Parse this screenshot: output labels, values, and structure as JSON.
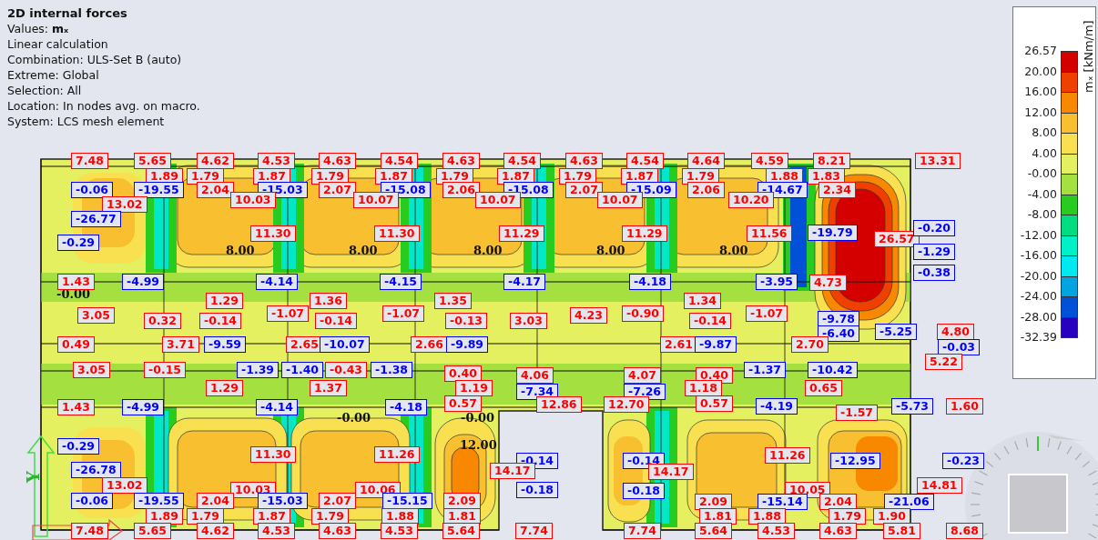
{
  "info": {
    "title": "2D internal forces",
    "lines": [
      "Values: **mₓ**",
      "Linear calculation",
      "Combination: ULS-Set B (auto)",
      "Extreme: Global",
      "Selection: All",
      "Location: In nodes avg. on macro.",
      "System: LCS mesh element"
    ]
  },
  "legend": {
    "title": "mₓ [kNm/m]",
    "ticks": [
      "26.57",
      "20.00",
      "16.00",
      "12.00",
      "8.00",
      "4.00",
      "-0.00",
      "-4.00",
      "-8.00",
      "-12.00",
      "-16.00",
      "-20.00",
      "-24.00",
      "-28.00",
      "-32.39"
    ],
    "bands": [
      {
        "color": "#d40000"
      },
      {
        "color": "#f04000"
      },
      {
        "color": "#f88800"
      },
      {
        "color": "#f8c030"
      },
      {
        "color": "#f8e050"
      },
      {
        "color": "#e4f060"
      },
      {
        "color": "#a4e040"
      },
      {
        "color": "#28cc20"
      },
      {
        "color": "#00dc80"
      },
      {
        "color": "#00f0c8"
      },
      {
        "color": "#00e8f0"
      },
      {
        "color": "#00a4e0"
      },
      {
        "color": "#0050d8"
      },
      {
        "color": "#2800c0"
      }
    ]
  },
  "axis": {
    "label": "Y"
  },
  "contour_labels": [
    "8.00",
    "8.00",
    "8.00",
    "8.00",
    "8.00",
    "-0.00",
    "-0.00",
    "-0.00",
    "12.00"
  ],
  "labels": [
    {
      "value": "7.48",
      "color": "#ff0000"
    },
    {
      "value": "5.65",
      "color": "#ff0000"
    },
    {
      "value": "4.62",
      "color": "#ff0000"
    },
    {
      "value": "4.53",
      "color": "#ff0000"
    },
    {
      "value": "4.63",
      "color": "#ff0000"
    },
    {
      "value": "4.54",
      "color": "#ff0000"
    },
    {
      "value": "4.63",
      "color": "#ff0000"
    },
    {
      "value": "4.54",
      "color": "#ff0000"
    },
    {
      "value": "4.63",
      "color": "#ff0000"
    },
    {
      "value": "4.54",
      "color": "#ff0000"
    },
    {
      "value": "4.64",
      "color": "#ff0000"
    },
    {
      "value": "4.59",
      "color": "#ff0000"
    },
    {
      "value": "8.21",
      "color": "#ff0000"
    },
    {
      "value": "13.31",
      "color": "#ff0000"
    },
    {
      "value": "1.89",
      "color": "#ff0000"
    },
    {
      "value": "1.79",
      "color": "#ff0000"
    },
    {
      "value": "1.87",
      "color": "#ff0000"
    },
    {
      "value": "1.79",
      "color": "#ff0000"
    },
    {
      "value": "1.87",
      "color": "#ff0000"
    },
    {
      "value": "1.79",
      "color": "#ff0000"
    },
    {
      "value": "1.87",
      "color": "#ff0000"
    },
    {
      "value": "1.79",
      "color": "#ff0000"
    },
    {
      "value": "1.87",
      "color": "#ff0000"
    },
    {
      "value": "1.79",
      "color": "#ff0000"
    },
    {
      "value": "1.88",
      "color": "#ff0000"
    },
    {
      "value": "1.83",
      "color": "#ff0000"
    },
    {
      "value": "-0.06",
      "color": "#0000ff"
    },
    {
      "value": "-19.55",
      "color": "#0000ff"
    },
    {
      "value": "2.04",
      "color": "#ff0000"
    },
    {
      "value": "-15.03",
      "color": "#0000ff"
    },
    {
      "value": "2.07",
      "color": "#ff0000"
    },
    {
      "value": "-15.08",
      "color": "#0000ff"
    },
    {
      "value": "2.06",
      "color": "#ff0000"
    },
    {
      "value": "-15.08",
      "color": "#0000ff"
    },
    {
      "value": "2.07",
      "color": "#ff0000"
    },
    {
      "value": "-15.09",
      "color": "#0000ff"
    },
    {
      "value": "2.06",
      "color": "#ff0000"
    },
    {
      "value": "-14.67",
      "color": "#0000ff"
    },
    {
      "value": "2.34",
      "color": "#ff0000"
    },
    {
      "value": "13.02",
      "color": "#ff0000"
    },
    {
      "value": "10.03",
      "color": "#ff0000"
    },
    {
      "value": "10.07",
      "color": "#ff0000"
    },
    {
      "value": "10.07",
      "color": "#ff0000"
    },
    {
      "value": "10.07",
      "color": "#ff0000"
    },
    {
      "value": "10.20",
      "color": "#ff0000"
    },
    {
      "value": "-26.77",
      "color": "#0000ff"
    },
    {
      "value": "11.30",
      "color": "#ff0000"
    },
    {
      "value": "11.30",
      "color": "#ff0000"
    },
    {
      "value": "11.29",
      "color": "#ff0000"
    },
    {
      "value": "11.29",
      "color": "#ff0000"
    },
    {
      "value": "11.56",
      "color": "#ff0000"
    },
    {
      "value": "-19.79",
      "color": "#0000ff"
    },
    {
      "value": "26.57",
      "color": "#ff0000"
    },
    {
      "value": "-0.20",
      "color": "#0000ff"
    },
    {
      "value": "-0.29",
      "color": "#0000ff"
    },
    {
      "value": "-1.29",
      "color": "#0000ff"
    },
    {
      "value": "-0.38",
      "color": "#0000ff"
    },
    {
      "value": "1.43",
      "color": "#ff0000"
    },
    {
      "value": "-4.99",
      "color": "#0000ff"
    },
    {
      "value": "-4.14",
      "color": "#0000ff"
    },
    {
      "value": "-4.15",
      "color": "#0000ff"
    },
    {
      "value": "-4.17",
      "color": "#0000ff"
    },
    {
      "value": "-4.18",
      "color": "#0000ff"
    },
    {
      "value": "-3.95",
      "color": "#0000ff"
    },
    {
      "value": "4.73",
      "color": "#ff0000"
    },
    {
      "value": "1.29",
      "color": "#ff0000"
    },
    {
      "value": "1.36",
      "color": "#ff0000"
    },
    {
      "value": "1.35",
      "color": "#ff0000"
    },
    {
      "value": "1.34",
      "color": "#ff0000"
    },
    {
      "value": "3.05",
      "color": "#ff0000"
    },
    {
      "value": "-1.07",
      "color": "#ff0000"
    },
    {
      "value": "-1.07",
      "color": "#ff0000"
    },
    {
      "value": "4.23",
      "color": "#ff0000"
    },
    {
      "value": "-0.90",
      "color": "#ff0000"
    },
    {
      "value": "-1.07",
      "color": "#ff0000"
    },
    {
      "value": "0.32",
      "color": "#ff0000"
    },
    {
      "value": "-0.14",
      "color": "#ff0000"
    },
    {
      "value": "-0.14",
      "color": "#ff0000"
    },
    {
      "value": "-0.13",
      "color": "#ff0000"
    },
    {
      "value": "3.03",
      "color": "#ff0000"
    },
    {
      "value": "-0.14",
      "color": "#ff0000"
    },
    {
      "value": "-9.78",
      "color": "#0000ff"
    },
    {
      "value": "-6.40",
      "color": "#0000ff"
    },
    {
      "value": "-5.25",
      "color": "#0000ff"
    },
    {
      "value": "4.80",
      "color": "#ff0000"
    },
    {
      "value": "0.49",
      "color": "#ff0000"
    },
    {
      "value": "3.71",
      "color": "#ff0000"
    },
    {
      "value": "-9.59",
      "color": "#0000ff"
    },
    {
      "value": "2.65",
      "color": "#ff0000"
    },
    {
      "value": "-10.07",
      "color": "#0000ff"
    },
    {
      "value": "2.66",
      "color": "#ff0000"
    },
    {
      "value": "-9.89",
      "color": "#0000ff"
    },
    {
      "value": "2.61",
      "color": "#ff0000"
    },
    {
      "value": "-9.87",
      "color": "#0000ff"
    },
    {
      "value": "2.70",
      "color": "#ff0000"
    },
    {
      "value": "-0.03",
      "color": "#0000ff"
    },
    {
      "value": "3.05",
      "color": "#ff0000"
    },
    {
      "value": "-0.15",
      "color": "#ff0000"
    },
    {
      "value": "-1.39",
      "color": "#0000ff"
    },
    {
      "value": "-1.40",
      "color": "#0000ff"
    },
    {
      "value": "-0.43",
      "color": "#ff0000"
    },
    {
      "value": "-1.38",
      "color": "#0000ff"
    },
    {
      "value": "0.40",
      "color": "#ff0000"
    },
    {
      "value": "4.06",
      "color": "#ff0000"
    },
    {
      "value": "4.07",
      "color": "#ff0000"
    },
    {
      "value": "0.40",
      "color": "#ff0000"
    },
    {
      "value": "-1.37",
      "color": "#0000ff"
    },
    {
      "value": "-10.42",
      "color": "#0000ff"
    },
    {
      "value": "5.22",
      "color": "#ff0000"
    },
    {
      "value": "1.29",
      "color": "#ff0000"
    },
    {
      "value": "1.37",
      "color": "#ff0000"
    },
    {
      "value": "1.19",
      "color": "#ff0000"
    },
    {
      "value": "1.18",
      "color": "#ff0000"
    },
    {
      "value": "0.65",
      "color": "#ff0000"
    },
    {
      "value": "-7.34",
      "color": "#0000ff"
    },
    {
      "value": "-7.26",
      "color": "#0000ff"
    },
    {
      "value": "0.57",
      "color": "#ff0000"
    },
    {
      "value": "12.86",
      "color": "#ff0000"
    },
    {
      "value": "12.70",
      "color": "#ff0000"
    },
    {
      "value": "0.57",
      "color": "#ff0000"
    },
    {
      "value": "1.43",
      "color": "#ff0000"
    },
    {
      "value": "-4.99",
      "color": "#0000ff"
    },
    {
      "value": "-4.14",
      "color": "#0000ff"
    },
    {
      "value": "-4.18",
      "color": "#0000ff"
    },
    {
      "value": "-4.19",
      "color": "#0000ff"
    },
    {
      "value": "-1.57",
      "color": "#ff0000"
    },
    {
      "value": "-5.73",
      "color": "#0000ff"
    },
    {
      "value": "1.60",
      "color": "#ff0000"
    },
    {
      "value": "-0.29",
      "color": "#0000ff"
    },
    {
      "value": "11.30",
      "color": "#ff0000"
    },
    {
      "value": "11.26",
      "color": "#ff0000"
    },
    {
      "value": "-0.14",
      "color": "#0000ff"
    },
    {
      "value": "-0.14",
      "color": "#0000ff"
    },
    {
      "value": "11.26",
      "color": "#ff0000"
    },
    {
      "value": "-12.95",
      "color": "#0000ff"
    },
    {
      "value": "-0.23",
      "color": "#0000ff"
    },
    {
      "value": "-26.78",
      "color": "#0000ff"
    },
    {
      "value": "14.17",
      "color": "#ff0000"
    },
    {
      "value": "14.17",
      "color": "#ff0000"
    },
    {
      "value": "13.02",
      "color": "#ff0000"
    },
    {
      "value": "14.81",
      "color": "#ff0000"
    },
    {
      "value": "10.03",
      "color": "#ff0000"
    },
    {
      "value": "10.06",
      "color": "#ff0000"
    },
    {
      "value": "-0.18",
      "color": "#0000ff"
    },
    {
      "value": "-0.18",
      "color": "#0000ff"
    },
    {
      "value": "10.05",
      "color": "#ff0000"
    },
    {
      "value": "-0.06",
      "color": "#0000ff"
    },
    {
      "value": "-19.55",
      "color": "#0000ff"
    },
    {
      "value": "2.04",
      "color": "#ff0000"
    },
    {
      "value": "-15.03",
      "color": "#0000ff"
    },
    {
      "value": "2.07",
      "color": "#ff0000"
    },
    {
      "value": "-15.15",
      "color": "#0000ff"
    },
    {
      "value": "2.09",
      "color": "#ff0000"
    },
    {
      "value": "2.09",
      "color": "#ff0000"
    },
    {
      "value": "-15.14",
      "color": "#0000ff"
    },
    {
      "value": "2.04",
      "color": "#ff0000"
    },
    {
      "value": "-21.06",
      "color": "#0000ff"
    },
    {
      "value": "1.89",
      "color": "#ff0000"
    },
    {
      "value": "1.79",
      "color": "#ff0000"
    },
    {
      "value": "1.87",
      "color": "#ff0000"
    },
    {
      "value": "1.79",
      "color": "#ff0000"
    },
    {
      "value": "1.88",
      "color": "#ff0000"
    },
    {
      "value": "1.81",
      "color": "#ff0000"
    },
    {
      "value": "1.81",
      "color": "#ff0000"
    },
    {
      "value": "1.88",
      "color": "#ff0000"
    },
    {
      "value": "1.79",
      "color": "#ff0000"
    },
    {
      "value": "1.90",
      "color": "#ff0000"
    },
    {
      "value": "7.48",
      "color": "#ff0000"
    },
    {
      "value": "5.65",
      "color": "#ff0000"
    },
    {
      "value": "4.62",
      "color": "#ff0000"
    },
    {
      "value": "4.53",
      "color": "#ff0000"
    },
    {
      "value": "4.63",
      "color": "#ff0000"
    },
    {
      "value": "4.53",
      "color": "#ff0000"
    },
    {
      "value": "5.64",
      "color": "#ff0000"
    },
    {
      "value": "7.74",
      "color": "#ff0000"
    },
    {
      "value": "7.74",
      "color": "#ff0000"
    },
    {
      "value": "5.64",
      "color": "#ff0000"
    },
    {
      "value": "4.53",
      "color": "#ff0000"
    },
    {
      "value": "4.63",
      "color": "#ff0000"
    },
    {
      "value": "5.81",
      "color": "#ff0000"
    },
    {
      "value": "8.68",
      "color": "#ff0000"
    }
  ]
}
